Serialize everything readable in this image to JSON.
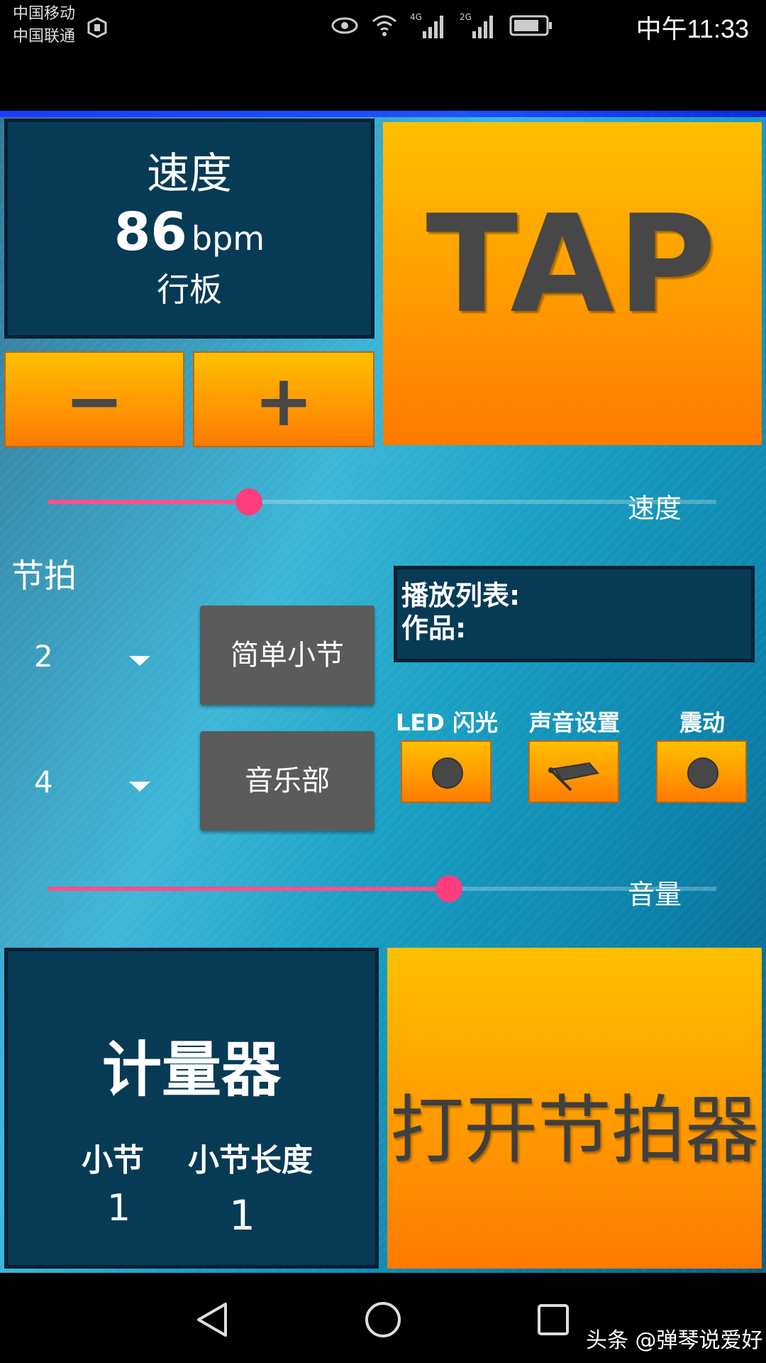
{
  "status_bar": {
    "carrier1": "中国移动",
    "carrier2": "中国联通",
    "network1": "4G",
    "network2": "2G",
    "time": "中午11:33"
  },
  "tempo": {
    "title": "速度",
    "value": "86",
    "unit": "bpm",
    "name": "行板"
  },
  "buttons": {
    "tap": "TAP",
    "minus": "−",
    "plus": "+"
  },
  "speed_slider": {
    "label": "速度",
    "value_fraction": 0.3
  },
  "beats": {
    "label": "节拍",
    "numerator": "2",
    "denominator": "4",
    "simple_bar_button": "简单小节",
    "music_part_button": "音乐部"
  },
  "playlist": {
    "line1": "播放列表:",
    "line2": "作品:"
  },
  "options": {
    "led_label": "LED 闪光",
    "sound_label": "声音设置",
    "vibration_label": "震动"
  },
  "volume_slider": {
    "label": "音量",
    "value_fraction": 0.6
  },
  "counter": {
    "title": "计量器",
    "bar_label": "小节",
    "bar_length_label": "小节长度",
    "bar_value": "1",
    "bar_length_value": "1"
  },
  "start": {
    "label": "打开节拍器"
  },
  "watermark": "头条 @弹琴说爱好",
  "colors": {
    "accent_orange": "#ff9a00",
    "slider_pink": "#ff3d7f",
    "panel_dark": "#073a55"
  }
}
